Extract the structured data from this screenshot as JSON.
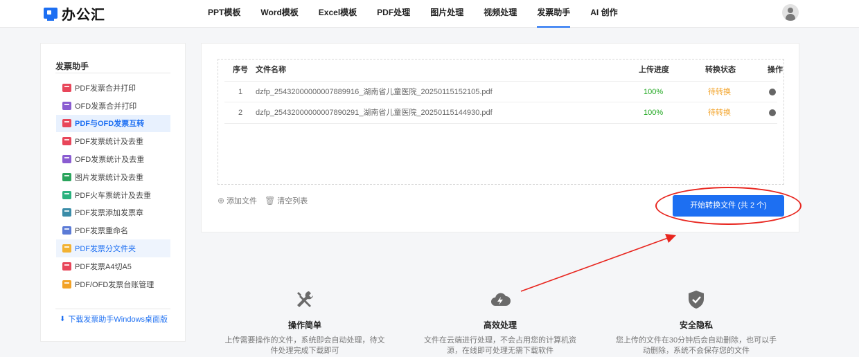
{
  "app": {
    "name": "办公汇"
  },
  "nav": [
    "PPT模板",
    "Word模板",
    "Excel模板",
    "PDF处理",
    "图片处理",
    "视频处理",
    "发票助手",
    "AI 创作"
  ],
  "sidebar": {
    "title": "发票助手",
    "items": [
      {
        "label": "PDF发票合并打印",
        "color": "#e8465a"
      },
      {
        "label": "OFD发票合并打印",
        "color": "#8a5cd1"
      },
      {
        "label": "PDF与OFD发票互转",
        "color": "#e8465a"
      },
      {
        "label": "PDF发票统计及去重",
        "color": "#e8465a"
      },
      {
        "label": "OFD发票统计及去重",
        "color": "#8a5cd1"
      },
      {
        "label": "图片发票统计及去重",
        "color": "#2aa45c"
      },
      {
        "label": "PDF火车票统计及去重",
        "color": "#2ab27e"
      },
      {
        "label": "PDF发票添加发票章",
        "color": "#3a8ca8"
      },
      {
        "label": "PDF发票重命名",
        "color": "#5b7bd6"
      },
      {
        "label": "PDF发票分文件夹",
        "color": "#f2b233"
      },
      {
        "label": "PDF发票A4切A5",
        "color": "#e8465a"
      },
      {
        "label": "PDF/OFD发票台账管理",
        "color": "#f2a227"
      }
    ],
    "download": "下载发票助手Windows桌面版"
  },
  "table": {
    "headers": {
      "index": "序号",
      "name": "文件名称",
      "progress": "上传进度",
      "status": "转换状态",
      "op": "操作"
    },
    "rows": [
      {
        "index": "1",
        "name": "dzfp_25432000000007889916_湖南省儿童医院_20250115152105.pdf",
        "progress": "100%",
        "status": "待转换"
      },
      {
        "index": "2",
        "name": "dzfp_25432000000007890291_湖南省儿童医院_20250115144930.pdf",
        "progress": "100%",
        "status": "待转换"
      }
    ]
  },
  "actions": {
    "add": "添加文件",
    "clear": "清空列表"
  },
  "start_button": "开始转换文件 (共 2 个)",
  "features": [
    {
      "title": "操作简单",
      "desc": "上传需要操作的文件，系统即会自动处理，待文件处理完成下载即可",
      "icon": "wrench-screwdriver-icon"
    },
    {
      "title": "高效处理",
      "desc": "文件在云端进行处理，不会占用您的计算机资源，在线即可处理无需下载软件",
      "icon": "cloud-lightning-icon"
    },
    {
      "title": "安全隐私",
      "desc": "您上传的文件在30分钟后会自动删除，也可以手动删除，系统不会保存您的文件",
      "icon": "shield-check-icon"
    }
  ],
  "colors": {
    "accent": "#1d6ff2",
    "success": "#22a822",
    "pending": "#f2a227",
    "annotation": "#e8261f"
  }
}
